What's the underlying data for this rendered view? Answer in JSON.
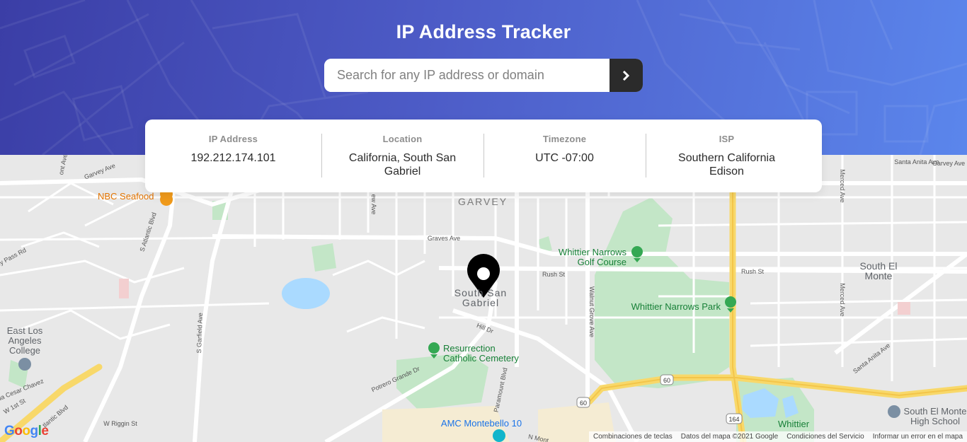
{
  "app": {
    "title": "IP Address Tracker"
  },
  "search": {
    "placeholder": "Search for any IP address or domain",
    "value": ""
  },
  "info": [
    {
      "label": "IP Address",
      "value": "192.212.174.101"
    },
    {
      "label": "Location",
      "value": "California, South San Gabriel"
    },
    {
      "label": "Timezone",
      "value": "UTC -07:00"
    },
    {
      "label": "ISP",
      "value": "Southern California Edison"
    }
  ],
  "map": {
    "places": {
      "garvey": "GARVEY",
      "south_san": "South San",
      "gabriel": "Gabriel",
      "south_el_monte_1": "South El",
      "south_el_monte_2": "Monte",
      "elac_1": "East Los",
      "elac_2": "Angeles",
      "elac_3": "College",
      "nbc": "NBC Seafood",
      "golf_1": "Whittier Narrows",
      "golf_2": "Golf Course",
      "park": "Whittier Narrows Park",
      "cemetery_1": "Resurrection",
      "cemetery_2": "Catholic Cemetery",
      "amc": "AMC Montebello 10",
      "hs_1": "South El Monte",
      "hs_2": "High School",
      "whittier": "Whittier"
    },
    "streets": {
      "graves": "Graves Ave",
      "rush_mid": "Rush St",
      "rush_right": "Rush St",
      "garvey_left": "Garvey Ave",
      "garvey_right": "Garvey Ave",
      "atlantic": "S Atlantic Blvd",
      "garfield": "S Garfield Ave",
      "hill": "Hill Dr",
      "walnut": "Walnut Grove Ave",
      "potrero": "Potrero Grande Dr",
      "paramount": "Paramount Blvd",
      "riggin": "W Riggin St",
      "santa_anita": "Santa Anita Ave",
      "merced_top": "Merced Ave",
      "merced_mid": "Merced Ave",
      "monterey_pass": "rey Pass Rd",
      "cesar": "da Cesar Chavez",
      "w_1st": "W 1st St",
      "atlantic_low": "tlantic Blvd",
      "new_ave": "ew Ave",
      "mont_ave": "ont Ave",
      "santa_anita_top": "Santa Anita Ave",
      "n_mont": "N Mont"
    },
    "shields": {
      "r60a": "60",
      "r60b": "60",
      "r164": "164"
    },
    "google": "Google",
    "attribution": [
      "Combinaciones de teclas",
      "Datos del mapa ©2021 Google",
      "Condiciones del Servicio",
      "Informar un error en el mapa"
    ]
  },
  "colors": {
    "header_start": "#3b3ea6",
    "header_end": "#5b86ec",
    "button": "#2b2b2b",
    "label": "#8d8d8d",
    "value": "#2b2b2b",
    "park_green": "#c3e6c7",
    "water": "#aadaff",
    "freeway": "#f8d86a"
  }
}
